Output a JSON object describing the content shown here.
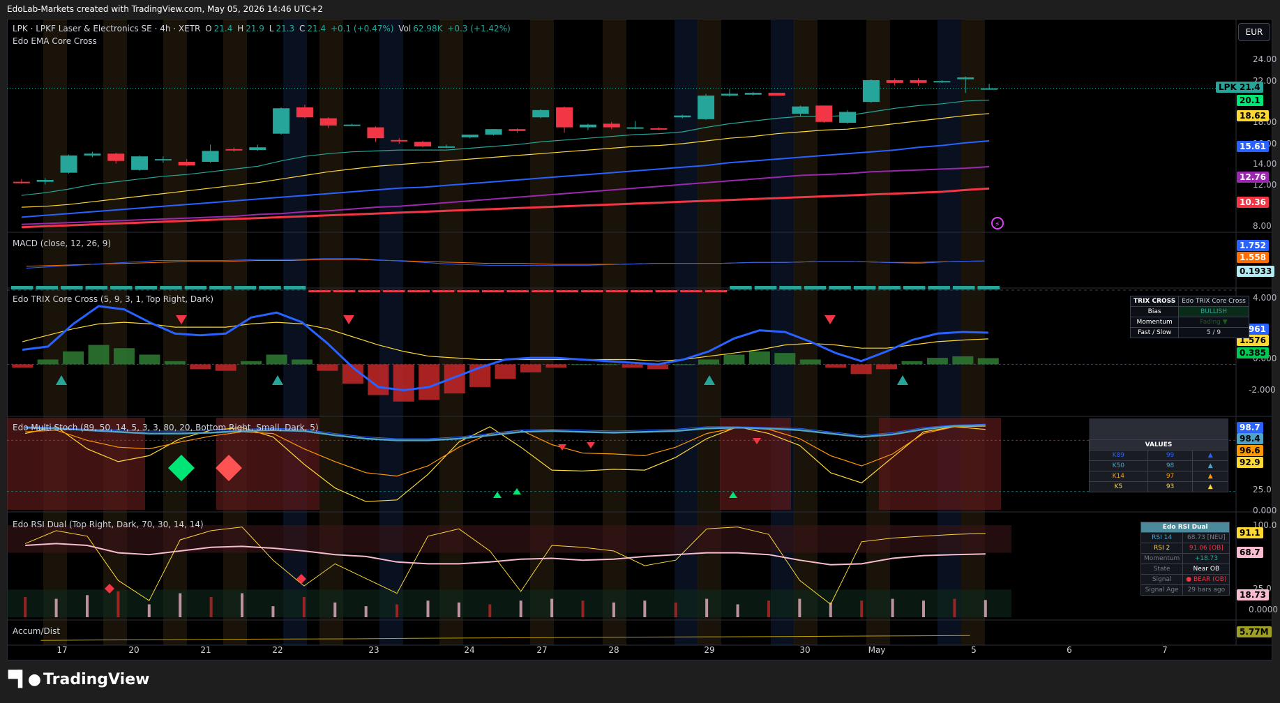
{
  "header": {
    "attribution": "EdoLab-Markets created with TradingView.com, May 05, 2026 14:46 UTC+2"
  },
  "main": {
    "symbol_line": "LPK · LPKF Laser & Electronics SE · 4h · XETR",
    "o_label": "O",
    "o_value": "21.4",
    "h_label": "H",
    "h_value": "21.9",
    "l_label": "L",
    "l_value": "21.3",
    "c_label": "C",
    "c_value": "21.4",
    "change": "+0.1 (+0.47%)",
    "vol_label": "Vol",
    "vol_value": "62.98K",
    "vol_change": "+0.3 (+1.42%)",
    "indicator": "Edo EMA Core Cross",
    "currency": "EUR",
    "symbol_tag": "LPK",
    "price_axis": [
      "24.00",
      "22.00",
      "18.00",
      "16.00",
      "14.00",
      "12.00",
      "8.00"
    ],
    "labels": [
      {
        "text": "21.4",
        "bg": "#26a69a",
        "fg": "#000000"
      },
      {
        "text": "20.1",
        "bg": "#00e676",
        "fg": "#000000"
      },
      {
        "text": "18.62",
        "bg": "#fdd835",
        "fg": "#000000"
      },
      {
        "text": "15.61",
        "bg": "#2962ff",
        "fg": "#ffffff"
      },
      {
        "text": "12.76",
        "bg": "#9c27b0",
        "fg": "#ffffff"
      },
      {
        "text": "10.36",
        "bg": "#f23645",
        "fg": "#ffffff"
      }
    ]
  },
  "macd": {
    "title": "MACD (close, 12, 26, 9)",
    "labels": [
      {
        "text": "1.752",
        "bg": "#2962ff",
        "fg": "#ffffff"
      },
      {
        "text": "1.558",
        "bg": "#ff6d00",
        "fg": "#ffffff"
      },
      {
        "text": "0.1933",
        "bg": "#b2ebf2",
        "fg": "#000000"
      }
    ]
  },
  "trix": {
    "title": "Edo TRIX Core Cross (5, 9, 3, 1, Top Right, Dark)",
    "axis": [
      "4.000",
      "0.000",
      "-2.000"
    ],
    "labels": [
      {
        "text": "1.961",
        "bg": "#2962ff",
        "fg": "#ffffff"
      },
      {
        "text": "1.576",
        "bg": "#fdd835",
        "fg": "#000000"
      },
      {
        "text": "0.385",
        "bg": "#00c853",
        "fg": "#000000"
      }
    ],
    "table": {
      "h1": "TRIX CROSS",
      "h2": "Edo TRIX Core Cross",
      "bias_label": "Bias",
      "bias_value": "BULLISH",
      "mom_label": "Momentum",
      "mom_value": "Fading ▼",
      "fs_label": "Fast / Slow",
      "fs_value": "5 / 9"
    }
  },
  "stoch": {
    "title": "Edo Multi Stoch (89, 50, 14, 5, 3, 3, 80, 20, Bottom Right, Small, Dark, 5)",
    "axis": [
      "25.0",
      "0.000"
    ],
    "labels": [
      {
        "text": "98.7",
        "bg": "#2962ff",
        "fg": "#ffffff"
      },
      {
        "text": "98.4",
        "bg": "#4fa3c7",
        "fg": "#000000"
      },
      {
        "text": "96.6",
        "bg": "#ff9800",
        "fg": "#000000"
      },
      {
        "text": "92.9",
        "bg": "#fdd835",
        "fg": "#000000"
      }
    ],
    "table": {
      "header": "VALUES",
      "rows": [
        {
          "k": "K89",
          "v": "99",
          "arrow": "▲",
          "color": "#2962ff"
        },
        {
          "k": "K50",
          "v": "98",
          "arrow": "▲",
          "color": "#4fa3c7"
        },
        {
          "k": "K14",
          "v": "97",
          "arrow": "▲",
          "color": "#ff9800"
        },
        {
          "k": "K5",
          "v": "93",
          "arrow": "▲",
          "color": "#fdd835"
        }
      ]
    }
  },
  "rsi": {
    "title": "Edo RSI Dual (Top Right, Dark, 70, 30, 14, 14)",
    "axis": [
      "100.0",
      "25.0",
      "0.0000"
    ],
    "labels": [
      {
        "text": "91.1",
        "bg": "#fdd835",
        "fg": "#000000"
      },
      {
        "text": "68.7",
        "bg": "#f8bbd0",
        "fg": "#000000"
      },
      {
        "text": "18.73",
        "bg": "#f8bbd0",
        "fg": "#000000"
      }
    ],
    "table": {
      "header": "Edo RSI Dual",
      "rows": [
        {
          "k": "RSI 14",
          "v": "68.73 [NEU]",
          "kc": "#4fa3c7",
          "vc": "#787b86"
        },
        {
          "k": "RSI 2",
          "v": "91.06 [OB]",
          "kc": "#fdd835",
          "vc": "#f23645"
        },
        {
          "k": "Momentum",
          "v": "+18.73",
          "kc": "#787b86",
          "vc": "#26a69a"
        },
        {
          "k": "State",
          "v": "Near OB",
          "kc": "#787b86",
          "vc": "#ffffff"
        },
        {
          "k": "Signal",
          "v": "● BEAR (OB)",
          "kc": "#787b86",
          "vc": "#f23645"
        },
        {
          "k": "Signal Age",
          "v": "29 bars ago",
          "kc": "#787b86",
          "vc": "#787b86"
        }
      ]
    }
  },
  "accum": {
    "title": "Accum/Dist",
    "labels": [
      {
        "text": "5.77M",
        "bg": "#9e9d24",
        "fg": "#000000"
      }
    ]
  },
  "xaxis": [
    "17",
    "20",
    "21",
    "22",
    "23",
    "24",
    "27",
    "28",
    "29",
    "30",
    "May",
    "5",
    "6",
    "7"
  ],
  "brand": {
    "name": "TradingView"
  },
  "colors": {
    "up": "#26a69a",
    "down": "#f23645",
    "background": "#000000"
  },
  "chart_data": {
    "type": "candlestick",
    "candles": [
      {
        "o": 11.1,
        "h": 11.4,
        "l": 10.9,
        "c": 11.0
      },
      {
        "o": 11.1,
        "h": 11.5,
        "l": 10.8,
        "c": 11.3
      },
      {
        "o": 12.1,
        "h": 14.1,
        "l": 12.0,
        "c": 14.0
      },
      {
        "o": 14.0,
        "h": 14.4,
        "l": 13.8,
        "c": 14.2
      },
      {
        "o": 14.2,
        "h": 14.3,
        "l": 13.1,
        "c": 13.4
      },
      {
        "o": 12.4,
        "h": 14.0,
        "l": 12.3,
        "c": 13.9
      },
      {
        "o": 13.6,
        "h": 13.9,
        "l": 13.2,
        "c": 13.6
      },
      {
        "o": 13.3,
        "h": 13.6,
        "l": 12.8,
        "c": 12.9
      },
      {
        "o": 13.3,
        "h": 15.2,
        "l": 13.2,
        "c": 14.5
      },
      {
        "o": 14.7,
        "h": 14.9,
        "l": 14.4,
        "c": 14.6
      },
      {
        "o": 14.6,
        "h": 15.2,
        "l": 14.5,
        "c": 14.9
      },
      {
        "o": 16.4,
        "h": 19.3,
        "l": 16.3,
        "c": 19.2
      },
      {
        "o": 19.3,
        "h": 19.6,
        "l": 18.1,
        "c": 18.2
      },
      {
        "o": 18.1,
        "h": 18.2,
        "l": 17.0,
        "c": 17.3
      },
      {
        "o": 17.4,
        "h": 17.5,
        "l": 17.3,
        "c": 17.4
      },
      {
        "o": 17.1,
        "h": 17.2,
        "l": 15.5,
        "c": 15.9
      },
      {
        "o": 15.7,
        "h": 15.9,
        "l": 15.3,
        "c": 15.6
      },
      {
        "o": 15.5,
        "h": 15.6,
        "l": 14.9,
        "c": 15.0
      },
      {
        "o": 15.0,
        "h": 15.2,
        "l": 14.8,
        "c": 15.0
      },
      {
        "o": 16.0,
        "h": 16.3,
        "l": 15.9,
        "c": 16.3
      },
      {
        "o": 16.3,
        "h": 16.9,
        "l": 16.2,
        "c": 16.9
      },
      {
        "o": 16.9,
        "h": 17.0,
        "l": 16.5,
        "c": 16.7
      },
      {
        "o": 18.2,
        "h": 19.1,
        "l": 18.1,
        "c": 19.0
      },
      {
        "o": 19.3,
        "h": 19.4,
        "l": 16.5,
        "c": 17.1
      },
      {
        "o": 17.1,
        "h": 17.5,
        "l": 16.8,
        "c": 17.4
      },
      {
        "o": 17.5,
        "h": 17.7,
        "l": 16.9,
        "c": 17.1
      },
      {
        "o": 17.0,
        "h": 17.8,
        "l": 16.9,
        "c": 17.1
      },
      {
        "o": 17.0,
        "h": 17.1,
        "l": 16.8,
        "c": 16.9
      },
      {
        "o": 18.2,
        "h": 18.5,
        "l": 18.1,
        "c": 18.4
      },
      {
        "o": 18.0,
        "h": 20.8,
        "l": 17.9,
        "c": 20.6
      },
      {
        "o": 20.6,
        "h": 21.3,
        "l": 20.5,
        "c": 20.8
      },
      {
        "o": 20.7,
        "h": 21.0,
        "l": 20.6,
        "c": 20.9
      },
      {
        "o": 20.9,
        "h": 20.9,
        "l": 20.6,
        "c": 20.6
      },
      {
        "o": 18.6,
        "h": 19.5,
        "l": 18.3,
        "c": 19.4
      },
      {
        "o": 19.5,
        "h": 19.5,
        "l": 17.6,
        "c": 17.7
      },
      {
        "o": 17.6,
        "h": 19.0,
        "l": 17.5,
        "c": 18.8
      },
      {
        "o": 19.9,
        "h": 22.4,
        "l": 19.8,
        "c": 22.3
      },
      {
        "o": 22.3,
        "h": 22.5,
        "l": 21.7,
        "c": 22.0
      },
      {
        "o": 22.3,
        "h": 22.5,
        "l": 21.7,
        "c": 22.0
      },
      {
        "o": 22.1,
        "h": 22.3,
        "l": 22.0,
        "c": 22.2
      },
      {
        "o": 22.4,
        "h": 22.7,
        "l": 20.9,
        "c": 22.6
      },
      {
        "o": 21.3,
        "h": 21.9,
        "l": 21.3,
        "c": 21.4
      }
    ],
    "ema_fast": [
      9.6,
      9.9,
      10.3,
      10.8,
      11.1,
      11.4,
      11.7,
      11.9,
      12.2,
      12.5,
      12.8,
      13.4,
      13.9,
      14.2,
      14.4,
      14.5,
      14.6,
      14.6,
      14.6,
      14.8,
      15.0,
      15.2,
      15.5,
      15.7,
      15.9,
      16.1,
      16.3,
      16.4,
      16.6,
      17.1,
      17.5,
      17.8,
      18.1,
      18.3,
      18.3,
      18.4,
      18.8,
      19.2,
      19.5,
      19.7,
      20.0,
      20.1
    ],
    "ema_mid": [
      8.3,
      8.4,
      8.6,
      8.9,
      9.2,
      9.5,
      9.8,
      10.1,
      10.4,
      10.7,
      11.0,
      11.4,
      11.8,
      12.2,
      12.5,
      12.8,
      13.0,
      13.2,
      13.4,
      13.6,
      13.8,
      14.0,
      14.2,
      14.4,
      14.6,
      14.8,
      15.0,
      15.1,
      15.3,
      15.6,
      15.9,
      16.1,
      16.4,
      16.6,
      16.8,
      16.9,
      17.2,
      17.5,
      17.8,
      18.1,
      18.4,
      18.62
    ],
    "ema_slow": [
      7.2,
      7.4,
      7.6,
      7.8,
      8.0,
      8.2,
      8.4,
      8.6,
      8.8,
      9.0,
      9.2,
      9.4,
      9.6,
      9.8,
      10.0,
      10.2,
      10.4,
      10.5,
      10.7,
      10.9,
      11.1,
      11.3,
      11.5,
      11.7,
      11.9,
      12.1,
      12.3,
      12.5,
      12.7,
      12.9,
      13.2,
      13.4,
      13.6,
      13.8,
      14.0,
      14.2,
      14.4,
      14.6,
      14.9,
      15.1,
      15.4,
      15.61
    ],
    "ema_slower": [
      6.4,
      6.5,
      6.6,
      6.7,
      6.8,
      6.9,
      7.0,
      7.1,
      7.2,
      7.3,
      7.5,
      7.6,
      7.8,
      7.9,
      8.1,
      8.3,
      8.4,
      8.6,
      8.8,
      9.0,
      9.2,
      9.4,
      9.6,
      9.8,
      10.0,
      10.2,
      10.4,
      10.6,
      10.8,
      11.0,
      11.2,
      11.4,
      11.6,
      11.8,
      11.9,
      12.0,
      12.2,
      12.3,
      12.4,
      12.5,
      12.6,
      12.76
    ],
    "ema_slowest": [
      6.1,
      6.2,
      6.3,
      6.4,
      6.5,
      6.6,
      6.7,
      6.8,
      6.9,
      7.0,
      7.1,
      7.2,
      7.3,
      7.4,
      7.5,
      7.6,
      7.7,
      7.8,
      7.9,
      8.0,
      8.1,
      8.2,
      8.3,
      8.4,
      8.5,
      8.6,
      8.7,
      8.8,
      8.9,
      9.0,
      9.1,
      9.2,
      9.3,
      9.4,
      9.5,
      9.6,
      9.7,
      9.8,
      9.9,
      10.0,
      10.2,
      10.36
    ],
    "trix_fast": [
      0.9,
      1.1,
      2.5,
      3.6,
      3.4,
      2.6,
      1.9,
      1.8,
      1.9,
      2.9,
      3.2,
      2.6,
      1.3,
      -0.2,
      -1.4,
      -1.6,
      -1.4,
      -0.8,
      -0.2,
      0.3,
      0.4,
      0.4,
      0.3,
      0.2,
      0.1,
      0.0,
      0.3,
      0.8,
      1.6,
      2.1,
      2.0,
      1.4,
      0.7,
      0.2,
      0.8,
      1.5,
      1.9,
      2.0,
      1.96
    ],
    "trix_slow": [
      1.4,
      1.8,
      2.2,
      2.5,
      2.6,
      2.5,
      2.3,
      2.3,
      2.3,
      2.5,
      2.6,
      2.5,
      2.2,
      1.7,
      1.2,
      0.8,
      0.5,
      0.4,
      0.3,
      0.3,
      0.3,
      0.3,
      0.3,
      0.3,
      0.3,
      0.2,
      0.3,
      0.5,
      0.7,
      0.9,
      1.2,
      1.3,
      1.2,
      1.0,
      1.0,
      1.2,
      1.4,
      1.5,
      1.576
    ],
    "trix_hist": [
      -0.2,
      0.3,
      0.8,
      1.2,
      1.0,
      0.6,
      0.2,
      -0.3,
      -0.4,
      0.2,
      0.6,
      0.3,
      -0.4,
      -1.2,
      -1.9,
      -2.3,
      -2.2,
      -1.8,
      -1.4,
      -0.9,
      -0.5,
      -0.2,
      0.0,
      0.0,
      -0.2,
      -0.3,
      0.0,
      0.3,
      0.6,
      0.8,
      0.7,
      0.3,
      -0.2,
      -0.6,
      -0.3,
      0.2,
      0.4,
      0.5,
      0.385
    ],
    "stoch_k89": [
      96,
      95,
      93,
      92,
      91,
      91,
      92,
      93,
      94,
      93,
      88,
      84,
      82,
      82,
      84,
      88,
      92,
      93,
      92,
      91,
      92,
      93,
      96,
      96,
      95,
      94,
      90,
      86,
      89,
      95,
      98,
      98.7
    ],
    "stoch_k50": [
      95,
      94,
      92,
      90,
      88,
      88,
      89,
      91,
      92,
      91,
      86,
      82,
      80,
      80,
      82,
      86,
      90,
      91,
      90,
      89,
      90,
      91,
      94,
      95,
      94,
      92,
      88,
      84,
      87,
      93,
      97,
      98.4
    ],
    "stoch_k14": [
      90,
      92,
      80,
      72,
      70,
      78,
      85,
      90,
      88,
      70,
      55,
      42,
      38,
      50,
      72,
      88,
      92,
      75,
      65,
      64,
      62,
      72,
      88,
      95,
      93,
      82,
      62,
      50,
      64,
      88,
      96,
      96.6
    ],
    "stoch_k5": [
      88,
      96,
      70,
      55,
      62,
      82,
      92,
      95,
      84,
      52,
      24,
      8,
      10,
      40,
      78,
      96,
      72,
      45,
      44,
      46,
      45,
      60,
      82,
      96,
      88,
      74,
      42,
      30,
      60,
      90,
      96,
      92.9
    ],
    "rsi14": [
      78,
      80,
      78,
      70,
      68,
      72,
      76,
      77,
      75,
      72,
      68,
      66,
      60,
      58,
      58,
      60,
      63,
      64,
      62,
      63,
      66,
      68,
      70,
      70,
      68,
      62,
      57,
      58,
      64,
      67,
      68,
      68.7
    ],
    "rsi2": [
      80,
      94,
      88,
      40,
      18,
      84,
      94,
      98,
      62,
      34,
      58,
      42,
      26,
      88,
      96,
      72,
      28,
      78,
      76,
      72,
      56,
      62,
      96,
      98,
      90,
      40,
      14,
      82,
      86,
      88,
      90,
      91.1
    ],
    "rsi_bars": [
      22,
      20,
      24,
      28,
      14,
      26,
      22,
      26,
      12,
      22,
      16,
      12,
      14,
      18,
      16,
      14,
      18,
      20,
      18,
      16,
      18,
      16,
      20,
      14,
      18,
      20,
      16,
      18,
      20,
      18,
      20,
      18.73
    ],
    "accum_dist": [
      5.55,
      5.57,
      5.58,
      5.6,
      5.61,
      5.62,
      5.64,
      5.66,
      5.67,
      5.69,
      5.7,
      5.71,
      5.72,
      5.74,
      5.75,
      5.77
    ]
  }
}
